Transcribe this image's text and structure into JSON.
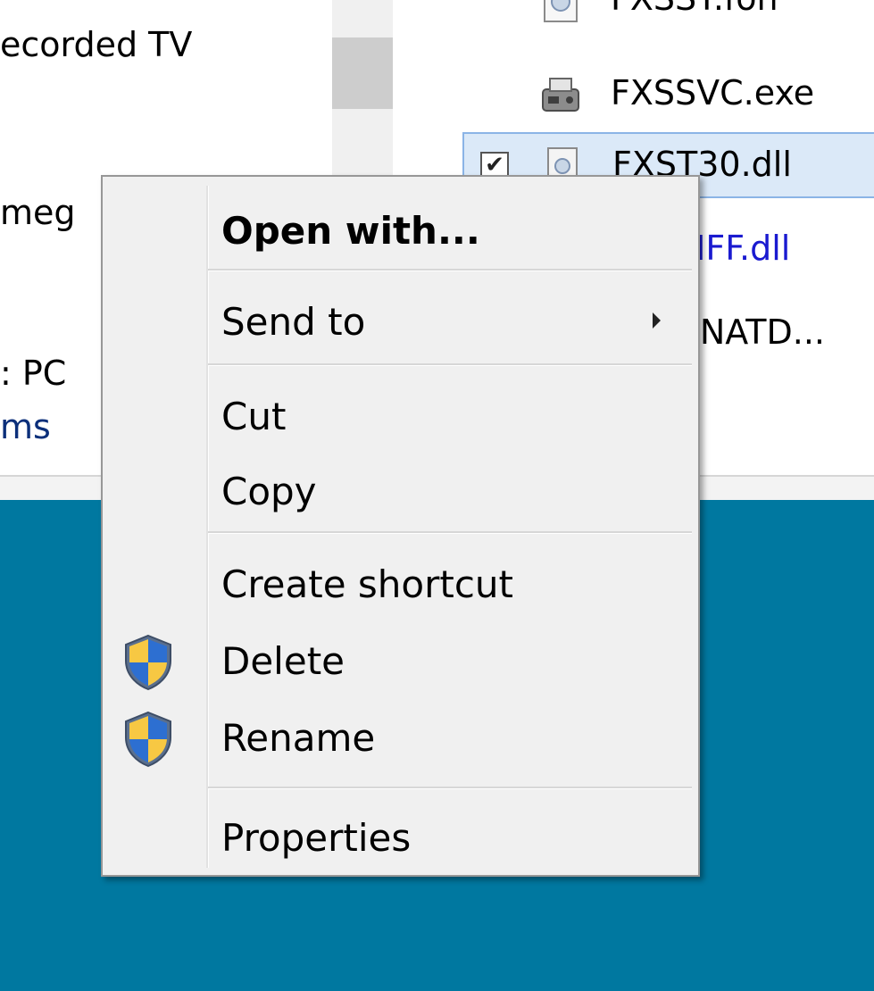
{
  "nav_pane": {
    "items": [
      "ecorded TV",
      "meg",
      ": PC",
      "ms"
    ]
  },
  "files": [
    {
      "name": "FXSST.fon",
      "icon": "document-icon",
      "selected": false
    },
    {
      "name": "FXSSVC.exe",
      "icon": "fax-icon",
      "selected": false
    },
    {
      "name": "FXST30.dll",
      "icon": "dll-icon",
      "selected": true
    },
    {
      "name": "FXSTIFF.dll",
      "icon": "dll-icon",
      "selected": false
    },
    {
      "name": "FXSUNATD...",
      "icon": "exe-icon",
      "selected": false
    }
  ],
  "context_menu": {
    "open_with": "Open with...",
    "send_to": "Send to",
    "cut": "Cut",
    "copy": "Copy",
    "create_shortcut": "Create shortcut",
    "delete": "Delete",
    "rename": "Rename",
    "properties": "Properties"
  },
  "colors": {
    "desktop": "#0078a0",
    "menu_bg": "#f0f0f0",
    "selection_bg": "#dbe9f8"
  }
}
